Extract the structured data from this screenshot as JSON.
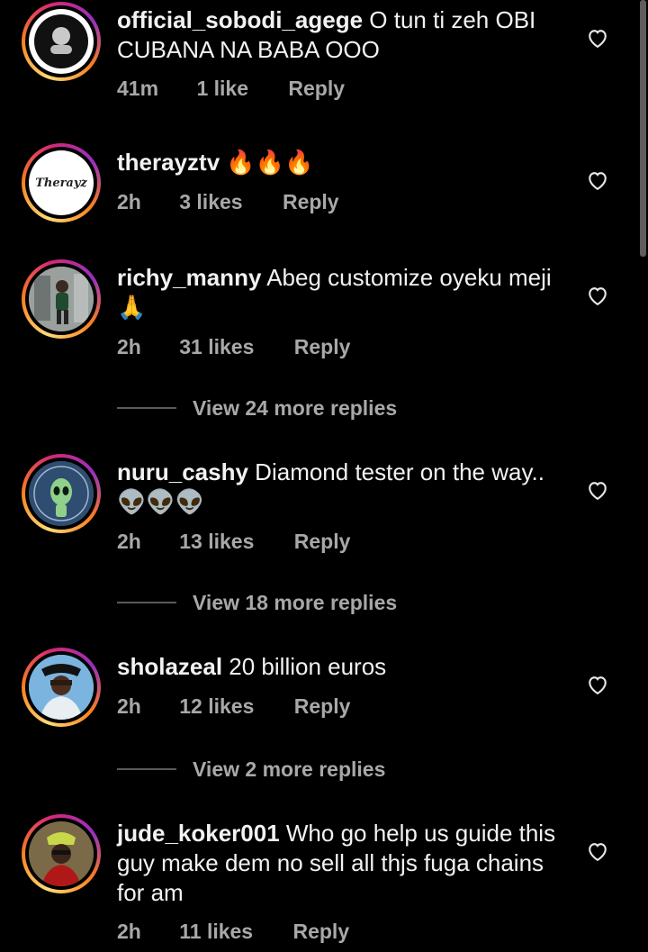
{
  "comments": [
    {
      "username": "official_sobodi_agege",
      "body": " O tun ti zeh OBI CUBANA NA BABA OOO",
      "time": "41m",
      "likes": "1 like",
      "reply": "Reply"
    },
    {
      "username": "therayztv",
      "body": " 🔥🔥🔥",
      "time": "2h",
      "likes": "3 likes",
      "reply": "Reply",
      "avatar_text": "Therayz"
    },
    {
      "username": "richy_manny",
      "body": " Abeg customize oyeku meji 🙏",
      "time": "2h",
      "likes": "31 likes",
      "reply": "Reply"
    },
    {
      "username": "nuru_cashy",
      "body": " Diamond tester on the way.. 👽👽👽",
      "time": "2h",
      "likes": "13 likes",
      "reply": "Reply"
    },
    {
      "username": "sholazeal",
      "body": " 20 billion euros",
      "time": "2h",
      "likes": "12 likes",
      "reply": "Reply"
    },
    {
      "username": "jude_koker001",
      "body": " Who go help us guide this guy make dem no sell all thjs fuga chains for am",
      "time": "2h",
      "likes": "11 likes",
      "reply": "Reply"
    }
  ],
  "view_replies": [
    "View 24 more replies",
    "View 18 more replies",
    "View 2 more replies"
  ],
  "icons": {
    "heart": "heart-outline-icon"
  },
  "colors": {
    "background": "#000000",
    "text": "#f2f2f2",
    "meta": "#a8a8a8",
    "story_ring_start": "#feda75",
    "story_ring_end": "#d62976"
  }
}
